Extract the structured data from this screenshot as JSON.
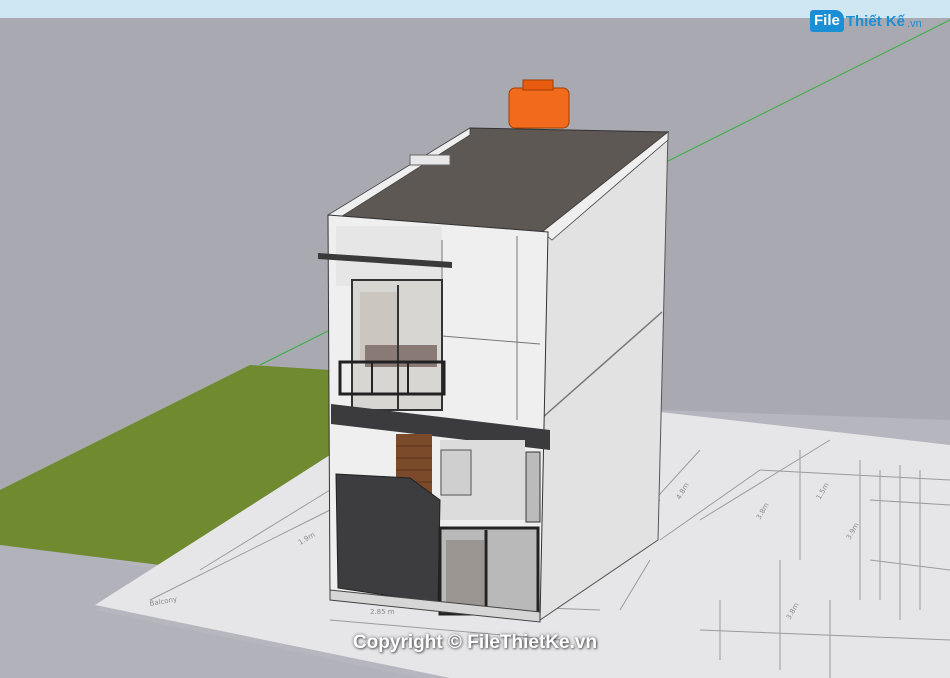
{
  "watermark": {
    "logo_file": "File",
    "logo_thietke": "Thiết Kế",
    "logo_vn": ".vn",
    "copyright": "Copyright © FileThietKe.vn"
  },
  "colors": {
    "sky": "#a9a9b1",
    "sky_band": "#cfe6f3",
    "grass": "#6f8a2f",
    "ground": "#b8b8c0",
    "plan_sheet": "#e6e6e9",
    "roof": "#5e5855",
    "wall": "#ededed",
    "water_tank": "#f26a1c",
    "gate": "#3d3d3f",
    "axis_green": "#2fb13a"
  },
  "icons": {
    "logo": "filethietke-logo-icon"
  }
}
